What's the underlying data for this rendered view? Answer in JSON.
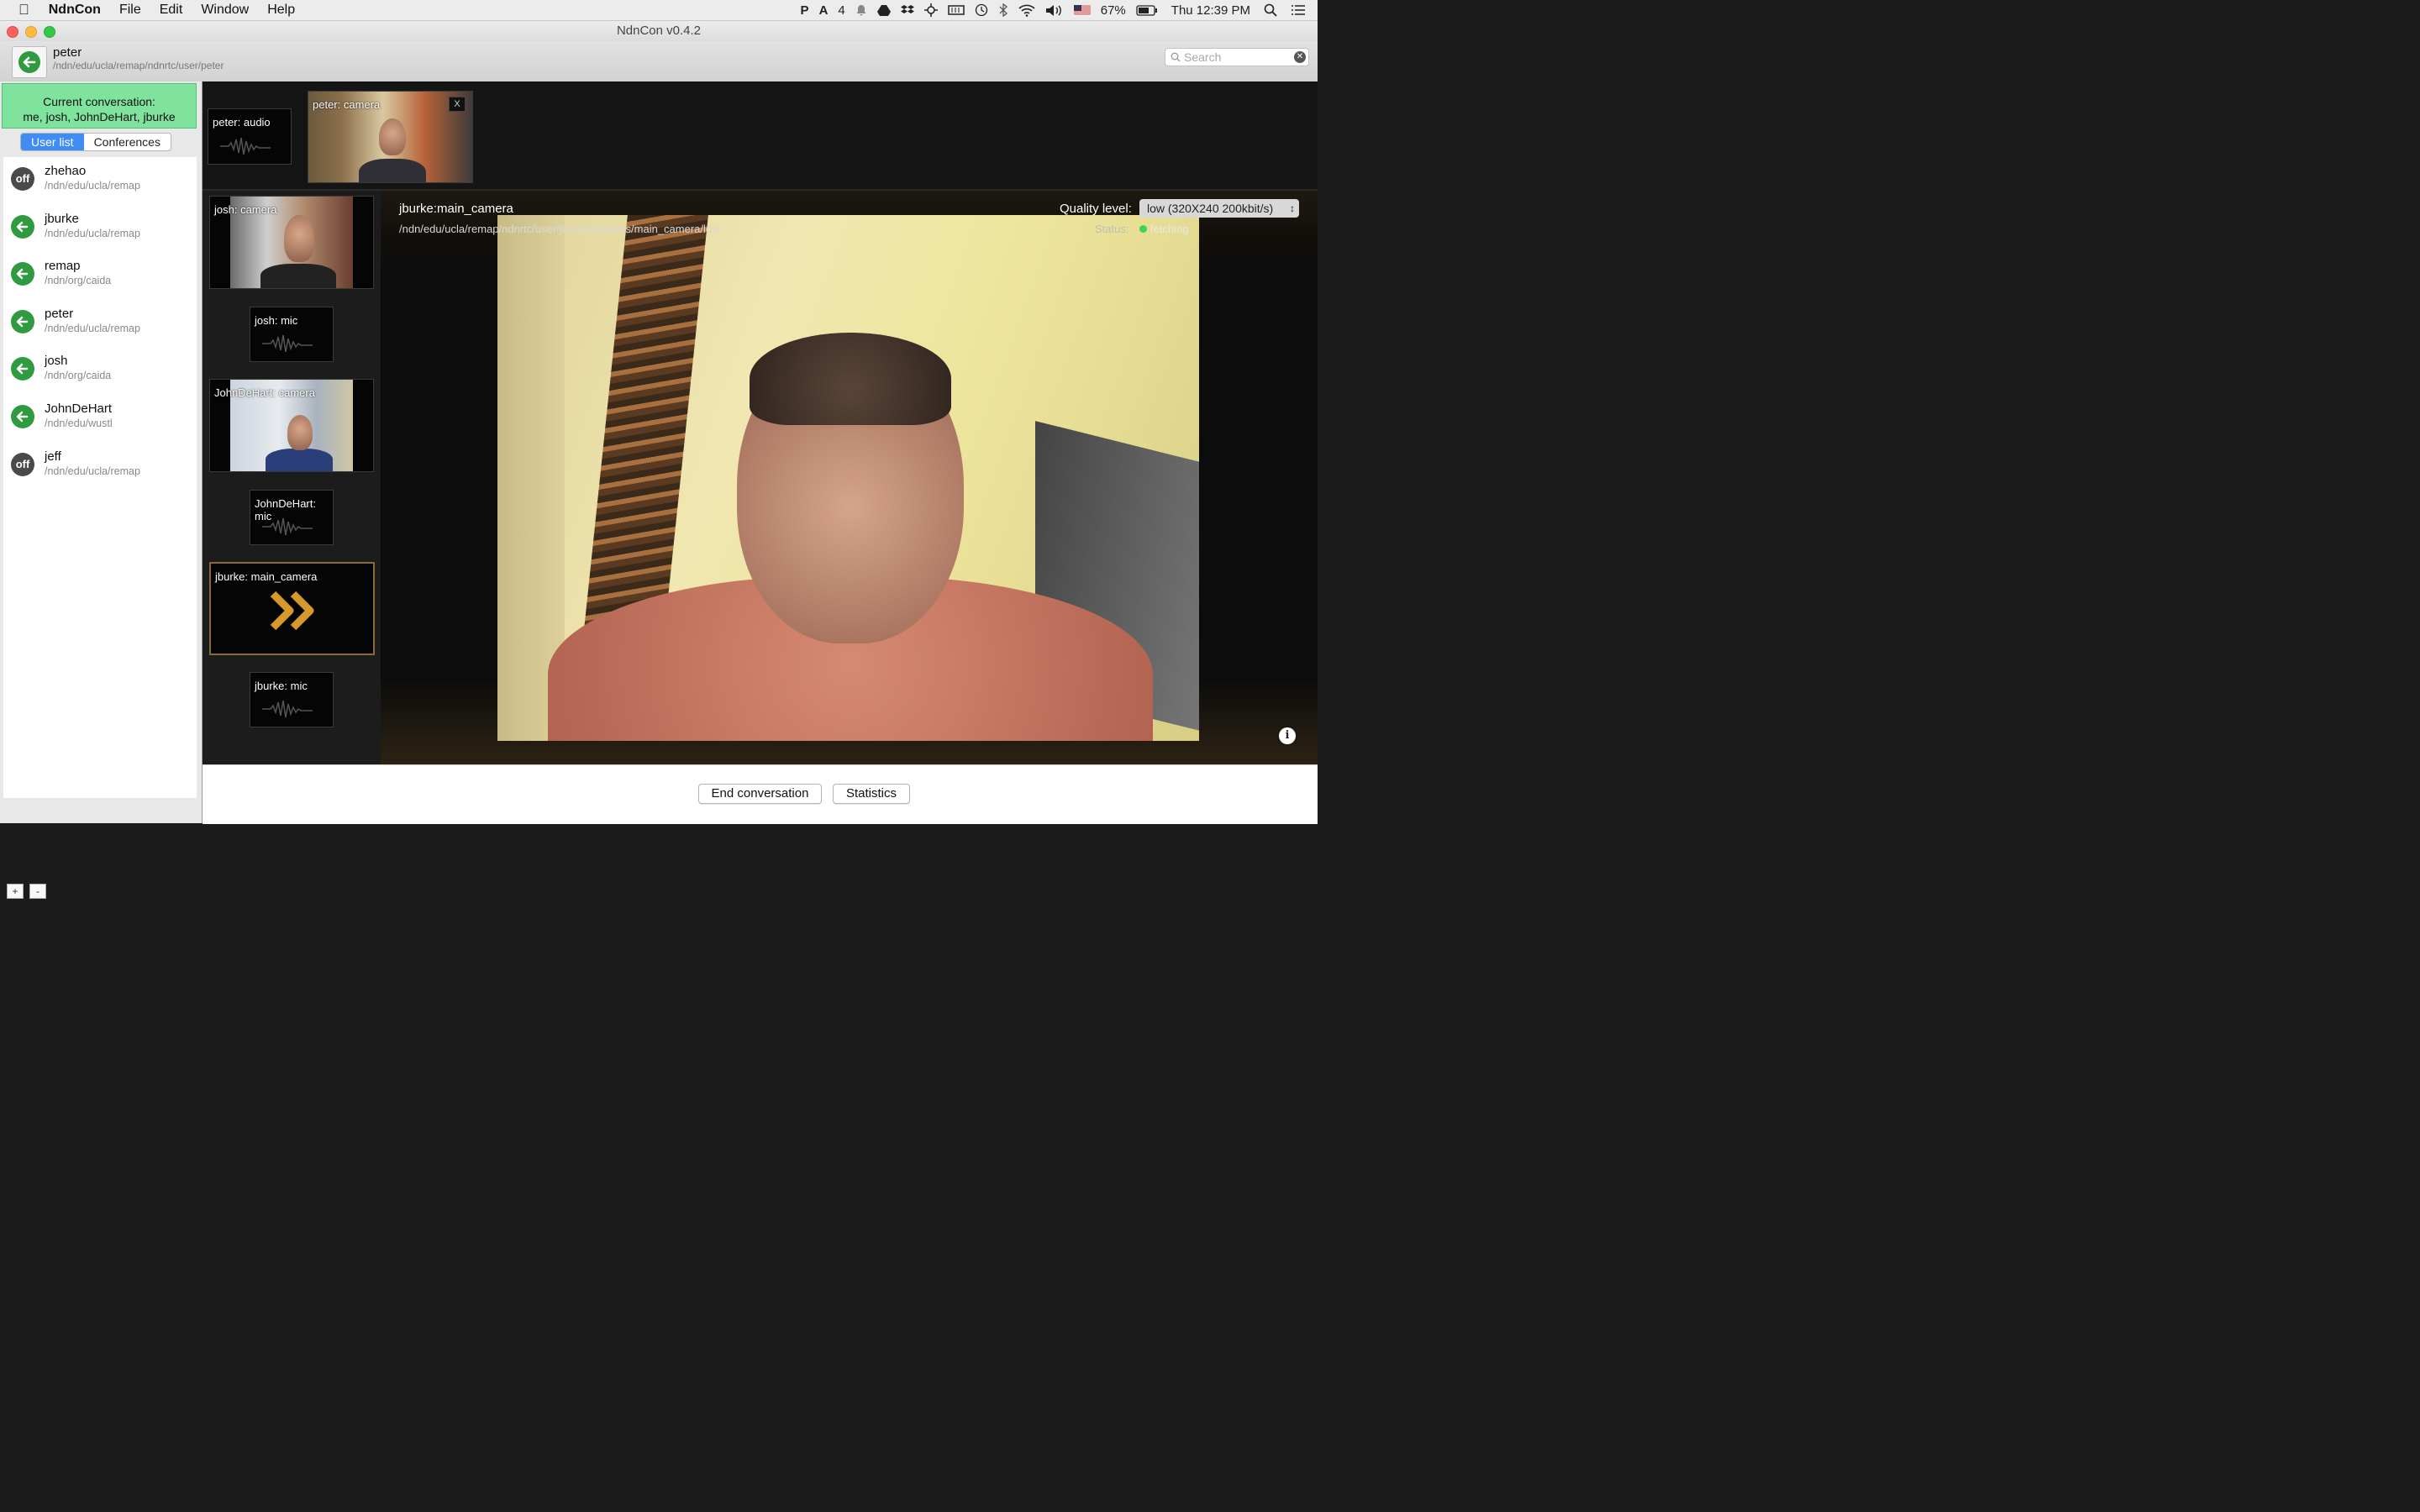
{
  "menubar": {
    "apple_icon": "apple-icon",
    "app_name": "NdnCon",
    "menus": [
      "File",
      "Edit",
      "Window",
      "Help"
    ],
    "tray_badge": "4",
    "battery": "67%",
    "clock": "Thu 12:39 PM"
  },
  "window": {
    "title": "NdnCon v0.4.2"
  },
  "toolbar": {
    "user_name": "peter",
    "user_path": "/ndn/edu/ucla/remap/ndnrtc/user/peter",
    "search_placeholder": "Search"
  },
  "sidebar": {
    "conversation_title": "Current conversation:",
    "conversation_members": "me, josh, JohnDeHart, jburke",
    "tabs": [
      {
        "label": "User list",
        "active": true
      },
      {
        "label": "Conferences",
        "active": false
      }
    ],
    "off_label": "off",
    "users": [
      {
        "name": "zhehao",
        "path": "/ndn/edu/ucla/remap",
        "status": "off"
      },
      {
        "name": "jburke",
        "path": "/ndn/edu/ucla/remap",
        "status": "on"
      },
      {
        "name": "remap",
        "path": "/ndn/org/caida",
        "status": "on"
      },
      {
        "name": "peter",
        "path": "/ndn/edu/ucla/remap",
        "status": "on"
      },
      {
        "name": "josh",
        "path": "/ndn/org/caida",
        "status": "on"
      },
      {
        "name": "JohnDeHart",
        "path": "/ndn/edu/wustl",
        "status": "on"
      },
      {
        "name": "jeff",
        "path": "/ndn/edu/ucla/remap",
        "status": "off"
      }
    ],
    "add_label": "+",
    "remove_label": "-"
  },
  "local_streams": {
    "audio_label": "peter: audio",
    "camera_label": "peter: camera",
    "close_label": "X"
  },
  "remote_streams": [
    {
      "label": "josh: camera",
      "kind": "video"
    },
    {
      "label": "josh: mic",
      "kind": "audio"
    },
    {
      "label": "JohnDeHart: camera",
      "kind": "video"
    },
    {
      "label": "JohnDeHart: mic",
      "kind": "audio"
    },
    {
      "label": "jburke: main_camera",
      "kind": "selected"
    },
    {
      "label": "jburke: mic",
      "kind": "audio"
    }
  ],
  "main_view": {
    "stream_title": "jburke:main_camera",
    "stream_path": "/ndn/edu/ucla/remap/ndnrtc/user/jburke/streams/main_camera/low",
    "quality_label": "Quality level:",
    "quality_value": "low (320X240 200kbit/s)",
    "status_label": "Status:",
    "status_value": "fetching",
    "status_color": "#3fd15a",
    "info_label": "i"
  },
  "actions": {
    "end_conversation": "End conversation",
    "statistics": "Statistics"
  },
  "colors": {
    "accent_green": "#7fe39e",
    "selected_tab": "#3f8df4",
    "online_icon": "#2f9a3f",
    "selected_arrow": "#d79a2a"
  }
}
